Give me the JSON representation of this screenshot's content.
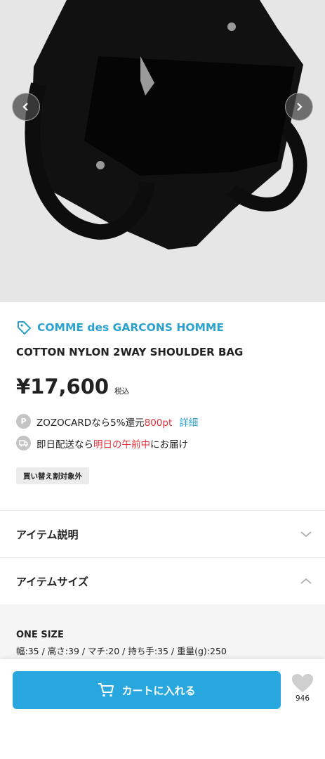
{
  "product": {
    "brand": "COMME des GARCONS HOMME",
    "name": "COTTON NYLON 2WAY SHOULDER BAG",
    "price": "¥17,600",
    "tax_label": "税込",
    "card_badge": "P",
    "card_promo": "ZOZOCARDなら5%還元",
    "card_points": "800pt",
    "card_link": "詳細",
    "delivery_prefix": "即日配送なら",
    "delivery_highlight": "明日の午前中",
    "delivery_suffix": "にお届け",
    "tag": "買い替え割対象外"
  },
  "sections": {
    "description_title": "アイテム説明",
    "size_title": "アイテムサイズ",
    "size_label": "ONE SIZE",
    "size_detail": "幅:35 / 高さ:39 / マチ:20 / 持ち手:35 / 重量(g):250"
  },
  "bottom_bar": {
    "cart_label": "カートに入れる",
    "favorite_count": "946"
  },
  "icons": {
    "brand": "tag-icon",
    "prev": "chevron-left-icon",
    "next": "chevron-right-icon",
    "delivery": "truck-icon",
    "expand": "chevron-down-icon",
    "collapse": "chevron-up-icon",
    "cart": "cart-icon",
    "favorite": "heart-icon"
  },
  "colors": {
    "accent": "#2aa1cf",
    "cart_button": "#29a8df",
    "highlight_red": "#e0303a",
    "bag": "#111111",
    "hero_background": "#e6e6e6"
  }
}
